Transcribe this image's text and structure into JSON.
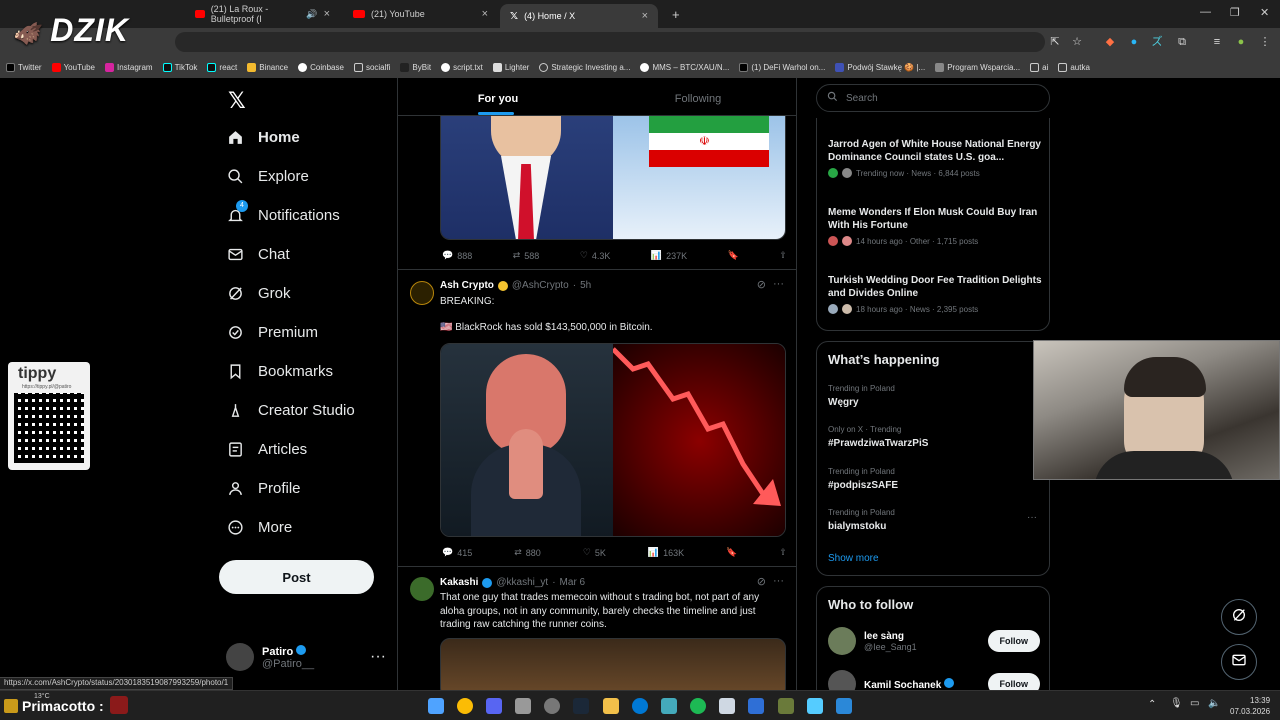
{
  "browser": {
    "tabs": [
      {
        "label": "(21) La Roux - Bulletproof (I",
        "active": false
      },
      {
        "label": "(21) YouTube",
        "active": false
      },
      {
        "label": "(4) Home / X",
        "active": true
      }
    ],
    "bookmarks": [
      "Twitter",
      "YouTube",
      "Instagram",
      "TikTok",
      "react",
      "Binance",
      "Coinbase",
      "socialfi",
      "ByBit",
      "script.txt",
      "Lighter",
      "Strategic Investing a...",
      "MMS – BTC/XAU/N...",
      "(1) DeFi Warhol on...",
      "Podwój Stawkę 🍪 |...",
      "Program Wsparcia...",
      "ai",
      "autka"
    ],
    "status_url": "https://x.com/AshCrypto/status/2030183519087993259/photo/1"
  },
  "overlay": {
    "brand": "DZIK",
    "tippy_title": "tippy",
    "tippy_sub": "https://tippy.pl/@patiro"
  },
  "nav": {
    "items": [
      {
        "label": "Home",
        "icon": "home-icon",
        "active": true
      },
      {
        "label": "Explore",
        "icon": "search-icon"
      },
      {
        "label": "Notifications",
        "icon": "bell-icon",
        "badge": "4"
      },
      {
        "label": "Chat",
        "icon": "mail-icon"
      },
      {
        "label": "Grok",
        "icon": "grok-icon"
      },
      {
        "label": "Premium",
        "icon": "premium-icon"
      },
      {
        "label": "Bookmarks",
        "icon": "bookmark-icon"
      },
      {
        "label": "Creator Studio",
        "icon": "creator-icon"
      },
      {
        "label": "Articles",
        "icon": "articles-icon"
      },
      {
        "label": "Profile",
        "icon": "profile-icon"
      },
      {
        "label": "More",
        "icon": "more-icon"
      }
    ],
    "post_label": "Post",
    "user": {
      "name": "Patiro",
      "handle": "@Patiro__"
    }
  },
  "feed": {
    "tabs": [
      "For you",
      "Following"
    ],
    "post0_stats": {
      "replies": "888",
      "reposts": "588",
      "likes": "4.3K",
      "views": "237K"
    },
    "post1": {
      "author": "Ash Crypto",
      "handle": "@AshCrypto",
      "time": "5h",
      "line1": "BREAKING:",
      "line2": "🇺🇸 BlackRock has sold $143,500,000 in Bitcoin.",
      "replies": "415",
      "reposts": "880",
      "likes": "5K",
      "views": "163K"
    },
    "post2": {
      "author": "Kakashi",
      "handle": "@kkashi_yt",
      "time": "Mar 6",
      "text": "That one guy that trades memecoin without s trading bot, not part of any aloha groups, not in any community, barely checks the timeline and just trading raw catching the runner coins."
    }
  },
  "right": {
    "search_placeholder": "Search",
    "news": [
      {
        "title": "Jarrod Agen of White House National Energy Dominance Council states U.S. goa...",
        "meta": "Trending now · News · 6,844 posts"
      },
      {
        "title": "Meme Wonders If Elon Musk Could Buy Iran With His Fortune",
        "meta": "14 hours ago · Other · 1,715 posts"
      },
      {
        "title": "Turkish Wedding Door Fee Tradition Delights and Divides Online",
        "meta": "18 hours ago · News · 2,395 posts"
      }
    ],
    "happening_title": "What’s happening",
    "trends": [
      {
        "ctx": "Trending in Poland",
        "name": "Węgry"
      },
      {
        "ctx": "Only on X · Trending",
        "name": "#PrawdziwaTwarzPiS"
      },
      {
        "ctx": "Trending in Poland",
        "name": "#podpiszSAFE"
      },
      {
        "ctx": "Trending in Poland",
        "name": "bialymstoku"
      }
    ],
    "show_more": "Show more",
    "who_title": "Who to follow",
    "who": [
      {
        "name": "lee sàng",
        "handle": "@Iee_Sang1",
        "btn": "Follow"
      },
      {
        "name": "Kamil Sochanek",
        "handle": "",
        "btn": "Follow"
      }
    ]
  },
  "taskbar": {
    "temp": "13°C",
    "widget_name": "Primacotto :",
    "time": "13:39",
    "date": "07.03.2026"
  }
}
